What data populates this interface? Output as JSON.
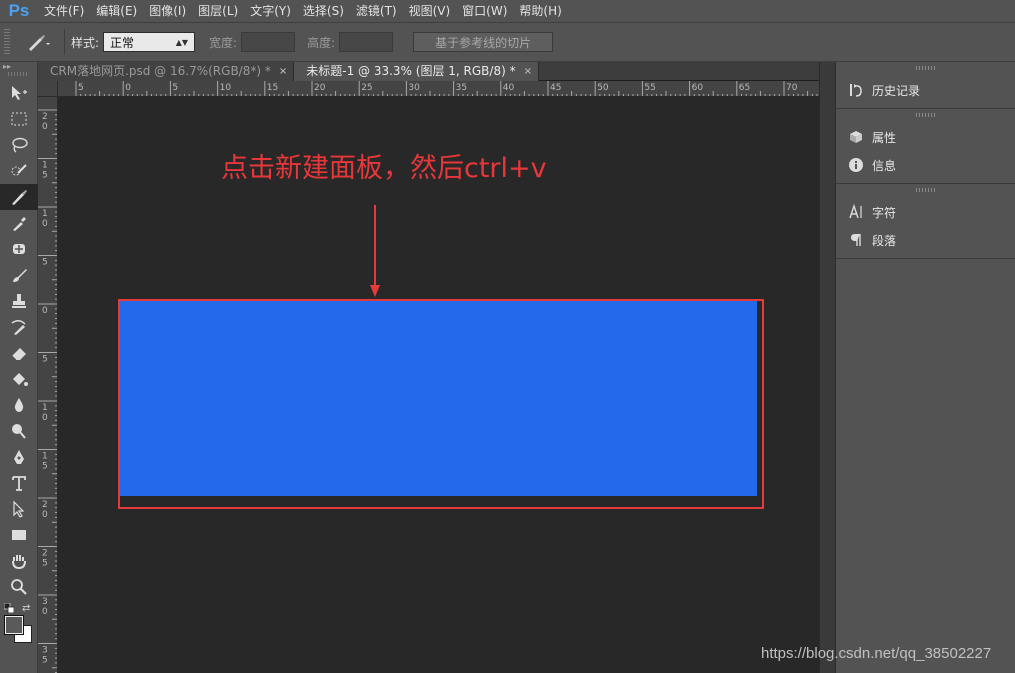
{
  "app": {
    "logo": "Ps"
  },
  "menu": [
    "文件(F)",
    "编辑(E)",
    "图像(I)",
    "图层(L)",
    "文字(Y)",
    "选择(S)",
    "滤镜(T)",
    "视图(V)",
    "窗口(W)",
    "帮助(H)"
  ],
  "options": {
    "style_label": "样式:",
    "style_value": "正常",
    "width_label": "宽度:",
    "height_label": "高度:",
    "slice_button": "基于参考线的切片"
  },
  "tabs": [
    {
      "label": "CRM落地网页.psd @ 16.7%(RGB/8*) *",
      "close": "×"
    },
    {
      "label": "未标题-1 @ 33.3% (图层 1, RGB/8) *",
      "close": "×"
    }
  ],
  "rulers": {
    "horizontal": [
      "5",
      "0",
      "5",
      "10",
      "15",
      "20",
      "25",
      "30",
      "35",
      "40",
      "45",
      "50",
      "55",
      "60",
      "65",
      "70"
    ],
    "vertical": [
      "2 0",
      "1 5",
      "1 0",
      "5",
      "0",
      "5",
      "1 0",
      "1 5",
      "2 0",
      "2 5",
      "3 0",
      "3 5"
    ]
  },
  "annotation": {
    "text": "点击新建面板，然后ctrl+v",
    "color": "#e8373a"
  },
  "canvas": {
    "panel_color": "#2369ea",
    "highlight_color": "#e43a3a"
  },
  "panels": {
    "history": "历史记录",
    "properties": "属性",
    "info": "信息",
    "character": "字符",
    "paragraph": "段落"
  },
  "watermark": "https://blog.csdn.net/qq_38502227"
}
